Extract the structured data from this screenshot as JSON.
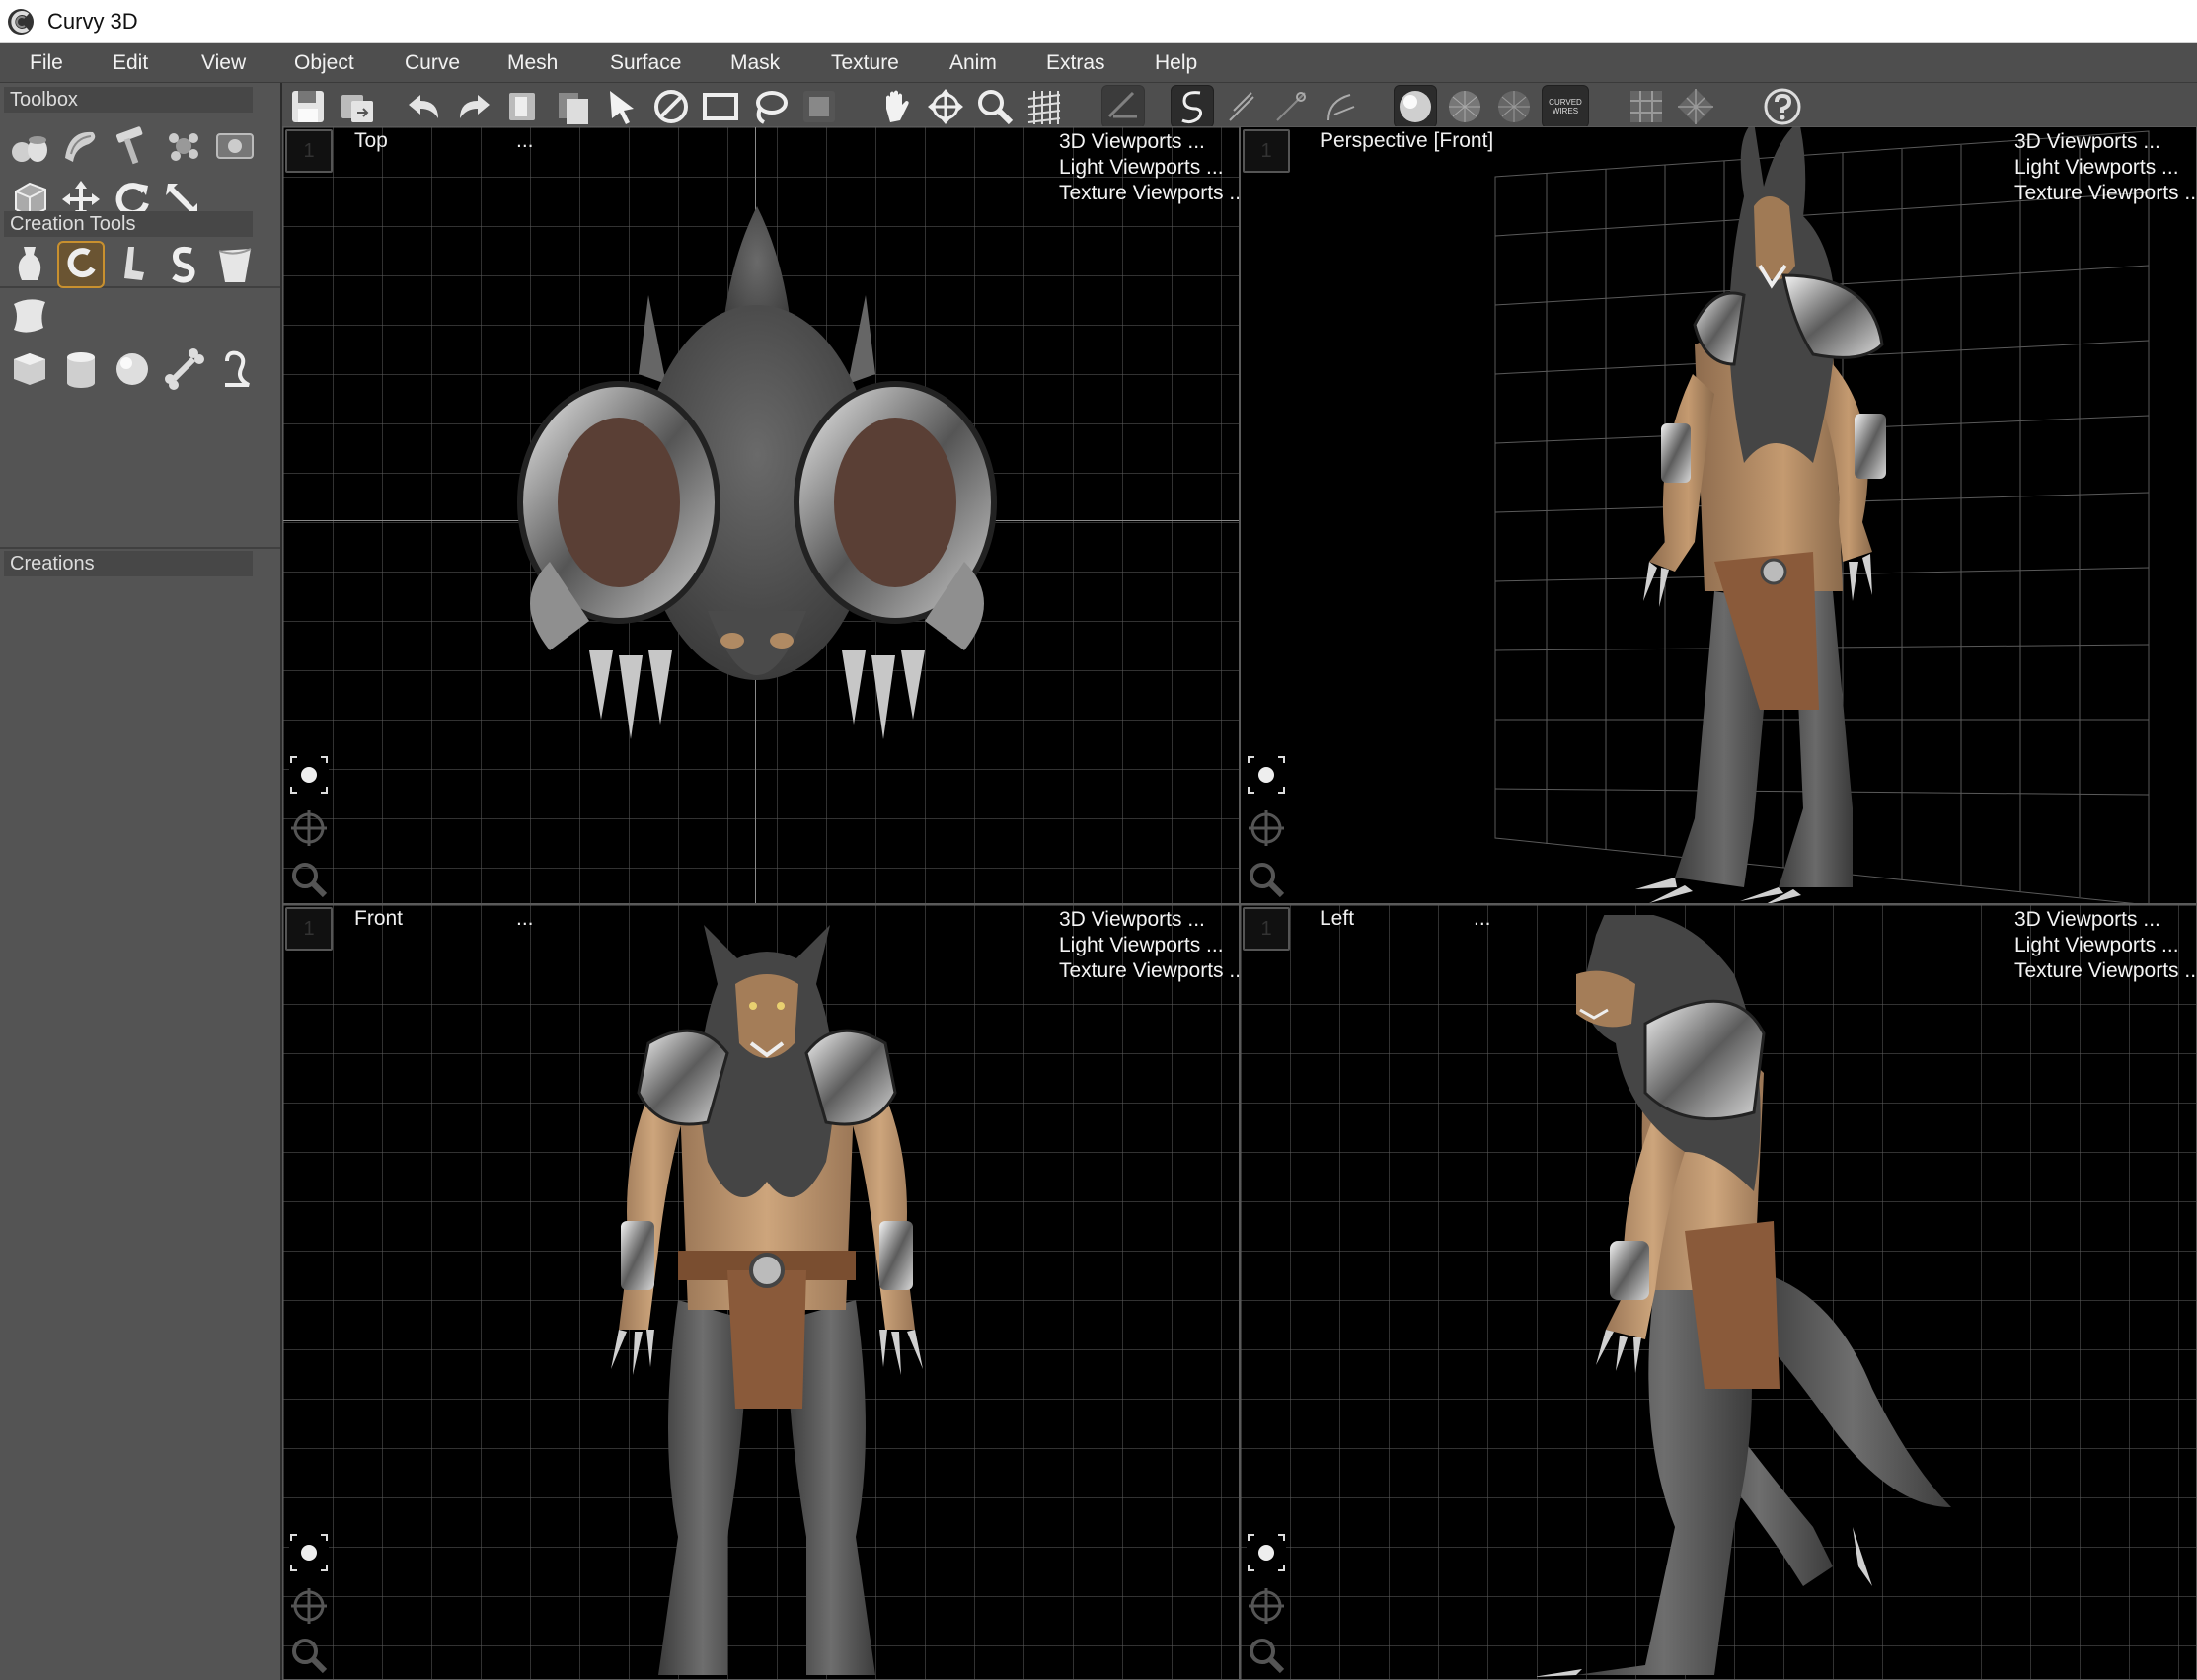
{
  "app": {
    "title": "Curvy 3D"
  },
  "menu": [
    "File",
    "Edit",
    "View",
    "Object",
    "Curve",
    "Mesh",
    "Surface",
    "Mask",
    "Texture",
    "Anim",
    "Extras",
    "Help"
  ],
  "left_panel": {
    "toolbox_header": "Toolbox",
    "creation_tools_header": "Creation Tools",
    "creations_header": "Creations",
    "toolbox_icons": [
      "pottery-icon",
      "tube-icon",
      "hammer-icon",
      "sculpt-brush-icon",
      "image-icon",
      "cube-frame-icon",
      "move-icon",
      "rotate-icon",
      "scale-arrow-icon"
    ],
    "creation_icons": [
      "vase-shape-icon",
      "curve-hook-icon",
      "bent-tube-icon",
      "s-curve-icon",
      "bucket-shape-icon",
      "sheet-shape-icon",
      "cube-primitive-icon",
      "cylinder-primitive-icon",
      "sphere-primitive-icon",
      "bone-primitive-icon",
      "hook-curve-icon"
    ],
    "active_creation_tool": "curve-hook-icon"
  },
  "toolbar": {
    "icons": [
      "save-icon",
      "save-as-icon",
      "undo-icon",
      "redo-icon",
      "copy-icon",
      "paste-icon",
      "select-arrow-icon",
      "no-select-icon",
      "rectangle-select-icon",
      "lasso-select-icon",
      "mask-select-icon",
      "pan-hand-icon",
      "move-cross-icon",
      "zoom-icon",
      "grid-icon",
      "edit-curve-icon",
      "curve-draw-icon",
      "curve-freehand-icon",
      "curve-points-icon",
      "curve-bezier-icon",
      "shaded-sphere-icon",
      "wire-sphere-icon",
      "hidden-wire-sphere-icon",
      "curved-wires-icon",
      "grid-toggle-icon",
      "diamond-grid-icon",
      "help-icon"
    ],
    "curved_wires_label": "CURVED WIRES"
  },
  "viewports": [
    {
      "number": "1",
      "title": "Top",
      "dots": "...",
      "menu": [
        "3D Viewports",
        "Light Viewports",
        "Texture Viewports"
      ],
      "menu_suffix": [
        "...",
        "...",
        "..."
      ]
    },
    {
      "number": "1",
      "title": "Perspective [Front]",
      "dots": "",
      "menu": [
        "3D Viewports",
        "Light Viewports",
        "Texture Viewports"
      ],
      "menu_suffix": [
        "...",
        "...",
        "..."
      ]
    },
    {
      "number": "1",
      "title": "Front",
      "dots": "...",
      "menu": [
        "3D Viewports",
        "Light Viewports",
        "Texture Viewports"
      ],
      "menu_suffix": [
        "...",
        "...",
        "..."
      ]
    },
    {
      "number": "1",
      "title": "Left",
      "dots": "...",
      "menu": [
        "3D Viewports",
        "Light Viewports",
        "Texture Viewports"
      ],
      "menu_suffix": [
        "...",
        "...",
        "..."
      ]
    }
  ],
  "colors": {
    "panel": "#545454",
    "menubar": "#4e4e4e",
    "accent": "#c8902f",
    "fur": "#5a5a5a",
    "skin": "#b08a63",
    "leather": "#8a5a3a",
    "metal": "#bfbfbf"
  }
}
